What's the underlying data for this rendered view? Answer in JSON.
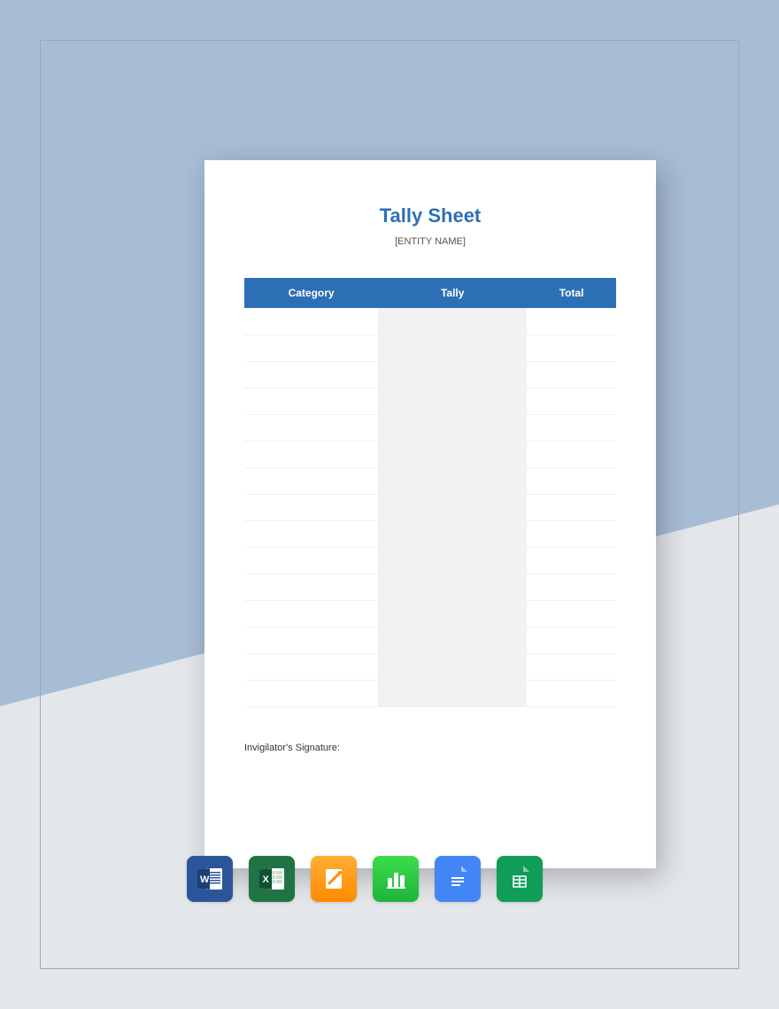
{
  "document": {
    "title": "Tally Sheet",
    "subtitle": "[ENTITY NAME]",
    "columns": [
      "Category",
      "Tally",
      "Total"
    ],
    "row_count": 15,
    "signature_label": "Invigilator's Signature:"
  },
  "icons": {
    "word": "word-icon",
    "excel": "excel-icon",
    "pages": "pages-icon",
    "numbers": "numbers-icon",
    "docs": "docs-icon",
    "sheets": "sheets-icon"
  },
  "colors": {
    "header_bg": "#2d6fb5",
    "title": "#2d6fb5",
    "frame_bg_top": "#a7bcd5",
    "frame_bg_bottom": "#e4e7ea"
  }
}
